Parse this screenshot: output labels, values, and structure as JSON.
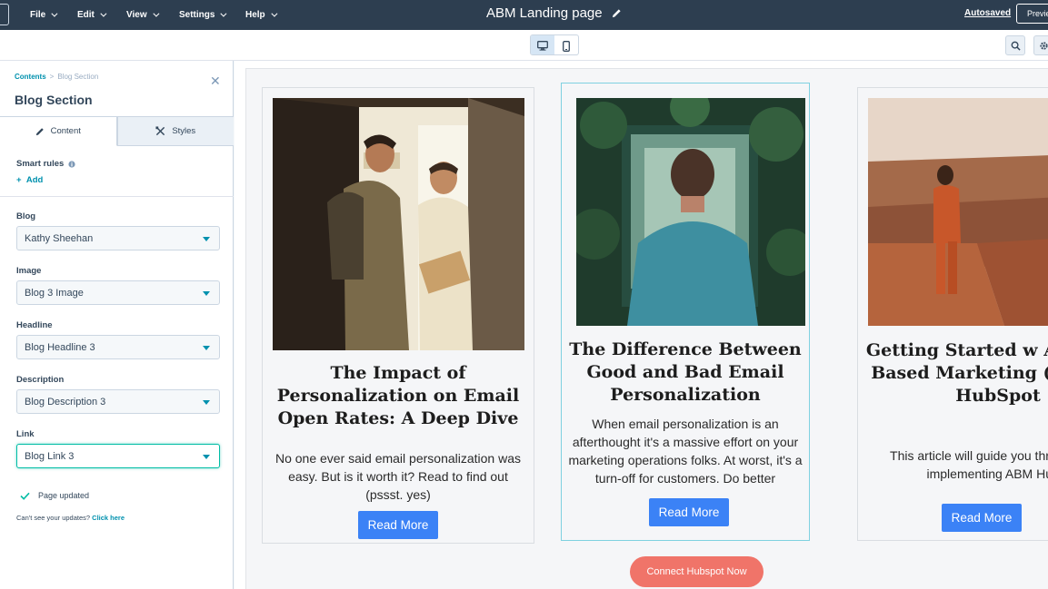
{
  "topbar": {
    "menus": [
      "File",
      "Edit",
      "View",
      "Settings",
      "Help"
    ],
    "doc_title": "ABM Landing page",
    "autosaved": "Autosaved",
    "preview": "Previe"
  },
  "sidebar": {
    "breadcrumb_root": "Contents",
    "breadcrumb_current": "Blog Section",
    "title": "Blog Section",
    "tabs": {
      "content": "Content",
      "styles": "Styles"
    },
    "smart_rules_label": "Smart rules",
    "add_label": "Add",
    "fields": [
      {
        "label": "Blog",
        "value": "Kathy Sheehan"
      },
      {
        "label": "Image",
        "value": "Blog 3 Image"
      },
      {
        "label": "Headline",
        "value": "Blog Headline 3"
      },
      {
        "label": "Description",
        "value": "Blog Description 3"
      },
      {
        "label": "Link",
        "value": "Blog Link 3"
      }
    ],
    "status": "Page updated",
    "cant_see_prefix": "Can't see your updates?",
    "click_here": "Click here"
  },
  "cards": [
    {
      "title": "The Impact of Personalization on Email Open Rates: A Deep Dive",
      "description": "No one ever said email personalization was easy. But is it worth it? Read to find out (pssst. yes)",
      "button": "Read More"
    },
    {
      "title": "The Difference Between Good and Bad Email Personalization",
      "description": "When email personalization is an afterthought it's a massive effort on your marketing operations folks. At worst, it's a turn-off for customers. Do better",
      "button": "Read More"
    },
    {
      "title": "Getting Started w Account-Based Marketing (ABM) u HubSpot",
      "description": "This article will guide you throu process of implementing ABM HubSpot.",
      "button": "Read More"
    }
  ],
  "connect_button": "Connect Hubspot Now",
  "colors": {
    "topbar": "#2d3e50",
    "accent": "#0091ae",
    "cta_blue": "#3b82f6",
    "connect": "#f07469",
    "focus": "#00bda5"
  }
}
